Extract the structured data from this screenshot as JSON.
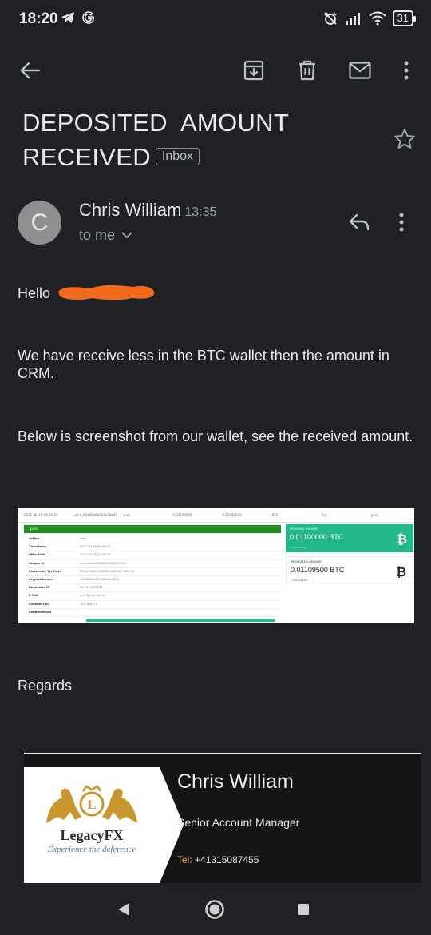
{
  "status_bar": {
    "time": "18:20",
    "battery": "31",
    "icons_left": [
      "telegram-icon",
      "google-icon"
    ],
    "icons_right": [
      "alarm-off-icon",
      "signal-icon",
      "wifi-icon",
      "battery-icon"
    ]
  },
  "toolbar": {
    "icons": [
      "back-arrow-icon",
      "archive-icon",
      "delete-icon",
      "mail-icon",
      "more-vert-icon"
    ]
  },
  "email": {
    "subject_line1": "DEPOSITED  AMOUNT",
    "subject_line2": "RECEIVED",
    "label": "Inbox",
    "sender_initial": "C",
    "sender_name": "Chris William",
    "time": "13:35",
    "recipient": "to me",
    "greeting": "Hello",
    "paragraph1": "We have receive less in the BTC wallet then the amount in CRM.",
    "paragraph2": "Below is screenshot from our wallet, see the received amount.",
    "closing": "Regards"
  },
  "wallet_screenshot": {
    "header_cells": [
      "2021-05-16 08:46:29",
      "usrid_60a0548b666b38a5f2fc3f",
      "wait",
      "0.01109500",
      "0.01100000",
      "BTC",
      "fiat",
      "paid"
    ],
    "status": "paid",
    "rows": [
      {
        "key": "Action",
        "value": "wait"
      },
      {
        "key": "Timestamp",
        "value": "2021-05-16 08:46:29"
      },
      {
        "key": "Offer Ends",
        "value": "2021-05-16 10:46:29"
      },
      {
        "key": "Unique Id",
        "value": "usrid_60a0548b666b38a5f2fc3f"
      },
      {
        "key": "Blockchain Tsx Hash",
        "value": "89ba208eb0c0f8f8fa2a8fb0a798ba7b"
      },
      {
        "key": "Cryptoaddress",
        "value": "1GEzB3r4vP3fWaSoJw4DsQ"
      },
      {
        "key": "Requester IP",
        "value": "46.251.220.242"
      },
      {
        "key": "E-Mail",
        "value": "user@provider.de"
      },
      {
        "key": "Customer Ip",
        "value": "192.168.1.5"
      },
      {
        "key": "Confirmations",
        "value": ""
      }
    ],
    "received_label": "RECEIVED AMOUNT",
    "received_amount": "0.01100000 BTC",
    "received_fiat": "≈ 610.00 EUR",
    "requested_label": "REQUESTED AMOUNT",
    "requested_amount": "0.01109500 BTC",
    "requested_fiat": "≈ 615.00 EUR",
    "btc_symbol": "₿"
  },
  "signature": {
    "name": "Chris William",
    "title": "Senior Account Manager",
    "tel_label": "Tel:",
    "tel_number": "+41315087455",
    "logo_name": "LegacyFX",
    "logo_tagline": "Experience the deference"
  },
  "nav_bar": {
    "icons": [
      "back-triangle-icon",
      "home-circle-icon",
      "recents-square-icon"
    ]
  }
}
